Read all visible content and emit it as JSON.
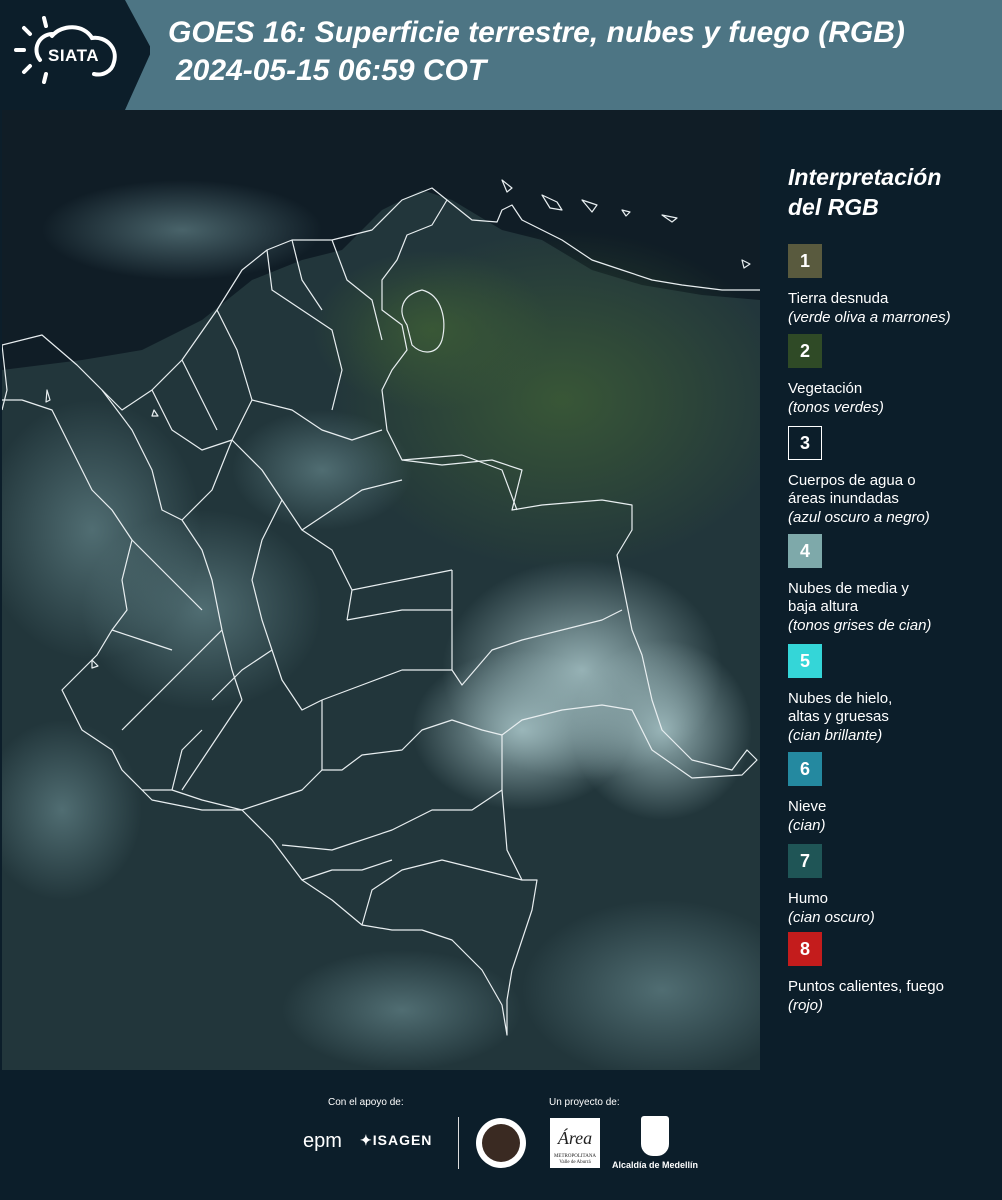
{
  "header": {
    "logo": "SIATA",
    "title": "GOES 16: Superficie terrestre, nubes y fuego (RGB)",
    "subtitle": "2024-05-15 06:59 COT"
  },
  "legend": {
    "title_line1": "Interpretación",
    "title_line2": "del RGB",
    "items": [
      {
        "num": "1",
        "label": "Tierra desnuda",
        "desc": "(verde oliva a marrones)",
        "color": "#595a3e"
      },
      {
        "num": "2",
        "label": "Vegetación",
        "desc": "(tonos verdes)",
        "color": "#2f4a26"
      },
      {
        "num": "3",
        "label_line1": "Cuerpos de agua o",
        "label_line2": "áreas inundadas",
        "desc": "(azul oscuro a negro)",
        "color": "#0c1e2a"
      },
      {
        "num": "4",
        "label_line1": "Nubes de media y",
        "label_line2": "baja altura",
        "desc": "(tonos grises de cian)",
        "color": "#7ea9aa"
      },
      {
        "num": "5",
        "label_line1": "Nubes de hielo,",
        "label_line2": "altas y gruesas",
        "desc": "(cian brillante)",
        "color": "#34d6d8"
      },
      {
        "num": "6",
        "label": "Nieve",
        "desc": "(cian)",
        "color": "#2489a0"
      },
      {
        "num": "7",
        "label": "Humo",
        "desc": "(cian oscuro)",
        "color": "#1f5556"
      },
      {
        "num": "8",
        "label": "Puntos calientes, fuego",
        "desc": "(rojo)",
        "color": "#c41c1c"
      }
    ]
  },
  "footer": {
    "support_label": "Con el apoyo de:",
    "project_label": "Un proyecto de:",
    "epm": "epm",
    "isagen": "ISAGEN",
    "area": "Área",
    "area_sub": "METROPOLITANA Valle de Aburrá",
    "alcaldia": "Alcaldía de Medellín"
  }
}
